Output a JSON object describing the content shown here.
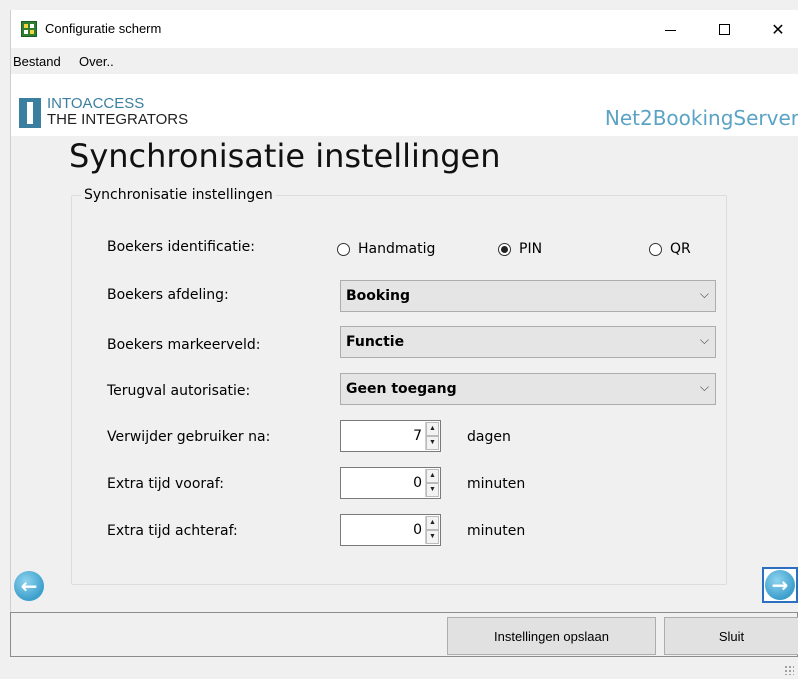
{
  "window": {
    "title": "Configuratie scherm",
    "minimize": "—",
    "close": "✕"
  },
  "menu": {
    "items": [
      "Bestand",
      "Over.."
    ]
  },
  "banner": {
    "logo_top": "INTOACCESS",
    "logo_bottom": "THE INTEGRATORS",
    "product": "Net2BookingServer"
  },
  "page": {
    "title": "Synchronisatie instellingen",
    "group_title": "Synchronisatie instellingen"
  },
  "form": {
    "identification": {
      "label": "Boekers identificatie:",
      "options": [
        "Handmatig",
        "PIN",
        "QR"
      ],
      "selected": "PIN"
    },
    "department": {
      "label": "Boekers afdeling:",
      "value": "Booking"
    },
    "marker_field": {
      "label": "Boekers markeerveld:",
      "value": "Functie"
    },
    "fallback_auth": {
      "label": "Terugval autorisatie:",
      "value": "Geen toegang"
    },
    "delete_user": {
      "label": "Verwijder gebruiker na:",
      "value": "7",
      "unit": "dagen"
    },
    "extra_before": {
      "label": "Extra tijd vooraf:",
      "value": "0",
      "unit": "minuten"
    },
    "extra_after": {
      "label": "Extra tijd achteraf:",
      "value": "0",
      "unit": "minuten"
    },
    "combo_arrow": "⌵"
  },
  "buttons": {
    "save": "Instellingen opslaan",
    "close": "Sluit"
  },
  "colors": {
    "brand": "#3b7fa0",
    "product": "#5ba3c4",
    "nav": "#3c9fcc"
  }
}
